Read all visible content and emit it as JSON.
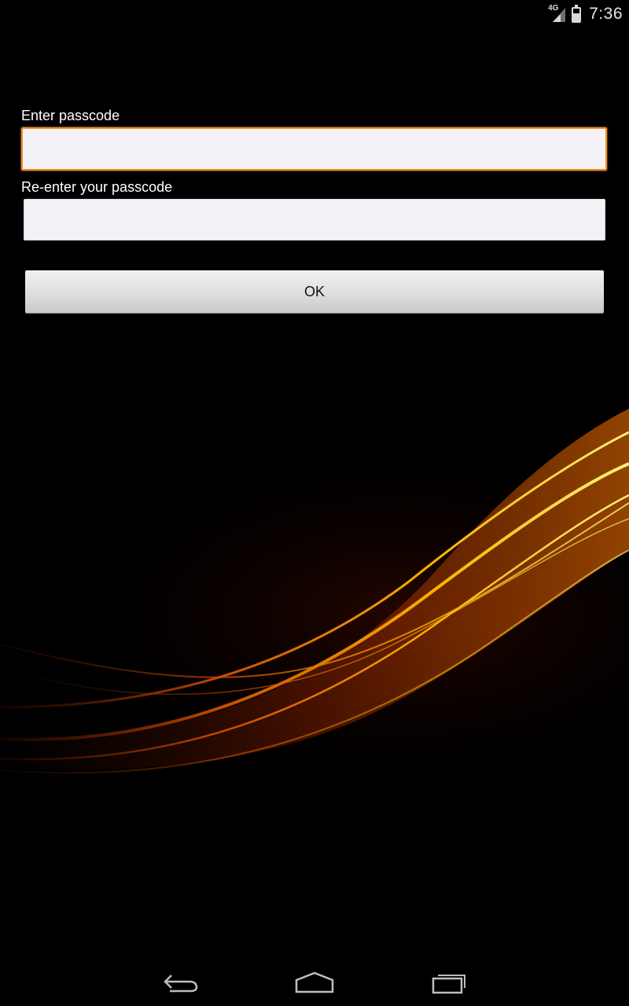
{
  "status_bar": {
    "network_type": "4G",
    "time": "7:36",
    "icons": [
      "signal-icon",
      "battery-icon"
    ]
  },
  "form": {
    "passcode_label": "Enter passcode",
    "passcode_value": "",
    "confirm_label": "Re-enter your passcode",
    "confirm_value": "",
    "ok_label": "OK"
  },
  "navigation": {
    "icons": [
      "back-icon",
      "home-icon",
      "recent-apps-icon"
    ]
  },
  "colors": {
    "focus_border": "#f28d1c",
    "background": "#000000",
    "field_background": "#f4f2f7"
  }
}
